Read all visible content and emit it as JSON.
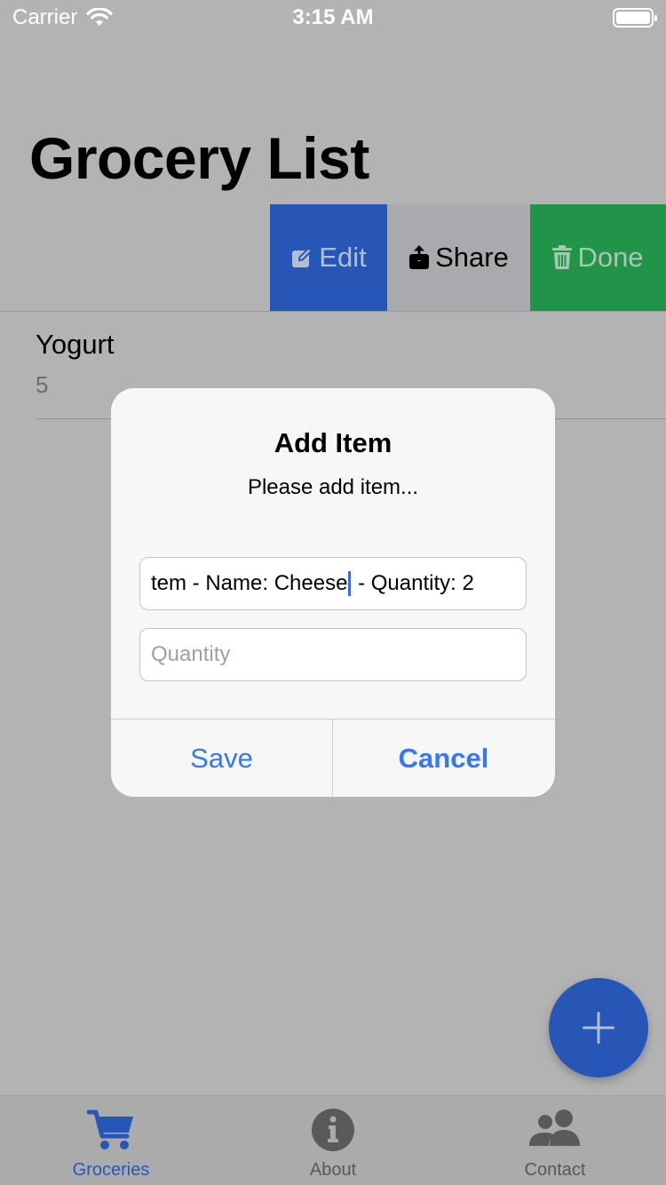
{
  "status_bar": {
    "carrier": "Carrier",
    "time": "3:15 AM"
  },
  "header": {
    "title": "Grocery List"
  },
  "swipe_actions": {
    "edit": {
      "label": "Edit",
      "icon": "edit-icon",
      "color": "#2657b6"
    },
    "share": {
      "label": "Share",
      "icon": "share-icon",
      "color": "#a8aaad"
    },
    "done": {
      "label": "Done",
      "icon": "trash-icon",
      "color": "#22944a"
    }
  },
  "list": {
    "items": [
      {
        "name": "Yogurt",
        "quantity": "5"
      }
    ]
  },
  "dialog": {
    "title": "Add Item",
    "message": "Please add item...",
    "name_field": {
      "value_before_caret": "tem - Name: Cheese",
      "value_after_caret": " - Quantity: 2"
    },
    "quantity_field": {
      "placeholder": "Quantity"
    },
    "save_label": "Save",
    "cancel_label": "Cancel",
    "accent_color": "#3478f6"
  },
  "fab": {
    "icon": "plus-icon"
  },
  "tab_bar": {
    "tabs": [
      {
        "label": "Groceries",
        "icon": "cart-icon",
        "active": true
      },
      {
        "label": "About",
        "icon": "info-icon",
        "active": false
      },
      {
        "label": "Contact",
        "icon": "people-icon",
        "active": false
      }
    ]
  }
}
